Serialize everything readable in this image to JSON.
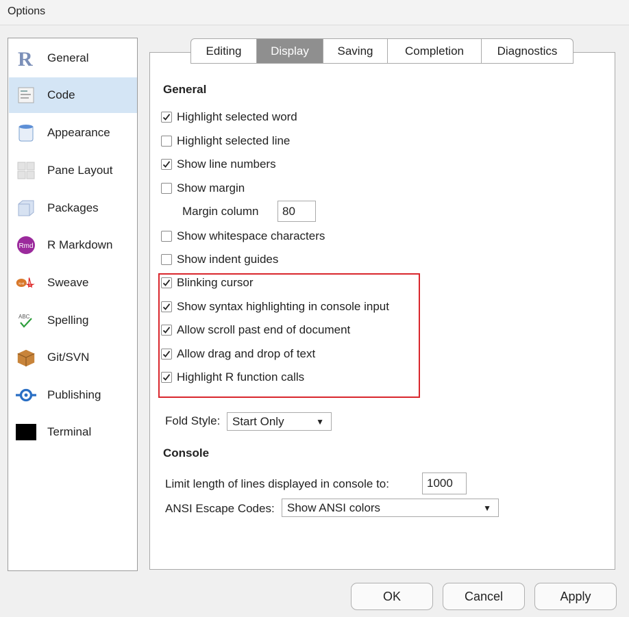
{
  "window": {
    "title": "Options"
  },
  "sidebar": {
    "items": [
      {
        "label": "General",
        "icon": "r-logo-icon"
      },
      {
        "label": "Code",
        "icon": "code-document-icon",
        "active": true
      },
      {
        "label": "Appearance",
        "icon": "paint-bucket-icon"
      },
      {
        "label": "Pane Layout",
        "icon": "pane-grid-icon"
      },
      {
        "label": "Packages",
        "icon": "package-box-icon"
      },
      {
        "label": "R Markdown",
        "icon": "rmd-icon"
      },
      {
        "label": "Sweave",
        "icon": "sweave-icon"
      },
      {
        "label": "Spelling",
        "icon": "spell-check-icon"
      },
      {
        "label": "Git/SVN",
        "icon": "git-box-icon"
      },
      {
        "label": "Publishing",
        "icon": "publish-icon"
      },
      {
        "label": "Terminal",
        "icon": "terminal-icon"
      }
    ]
  },
  "tabs": [
    "Editing",
    "Display",
    "Saving",
    "Completion",
    "Diagnostics"
  ],
  "active_tab": "Display",
  "general": {
    "title": "General",
    "options": [
      {
        "label": "Highlight selected word",
        "checked": true
      },
      {
        "label": "Highlight selected line",
        "checked": false
      },
      {
        "label": "Show line numbers",
        "checked": true
      },
      {
        "label": "Show margin",
        "checked": false
      },
      {
        "label": "Show whitespace characters",
        "checked": false
      },
      {
        "label": "Show indent guides",
        "checked": false
      },
      {
        "label": "Blinking cursor",
        "checked": true
      },
      {
        "label": "Show syntax highlighting in console input",
        "checked": true
      },
      {
        "label": "Allow scroll past end of document",
        "checked": true
      },
      {
        "label": "Allow drag and drop of text",
        "checked": true
      },
      {
        "label": "Highlight R function calls",
        "checked": true
      }
    ],
    "margin_column_label": "Margin column",
    "margin_column_value": "80",
    "fold_style_label": "Fold Style:",
    "fold_style_value": "Start Only"
  },
  "console": {
    "title": "Console",
    "limit_label": "Limit length of lines displayed in console to:",
    "limit_value": "1000",
    "ansi_label": "ANSI Escape Codes:",
    "ansi_value": "Show ANSI colors"
  },
  "buttons": {
    "ok": "OK",
    "cancel": "Cancel",
    "apply": "Apply"
  },
  "colors": {
    "highlight_border": "#d9262c",
    "active_tab": "#8f8f8f",
    "sidebar_selected": "#d4e5f5"
  }
}
